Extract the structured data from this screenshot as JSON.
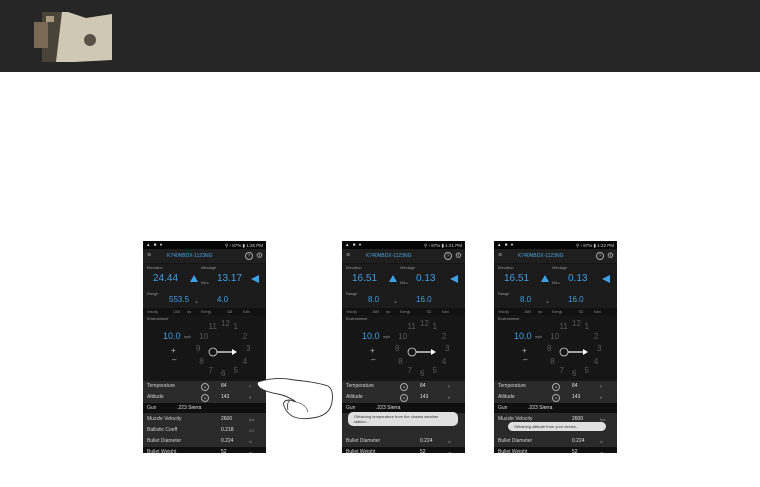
{
  "screens": [
    {
      "time": "1:26 PM",
      "device_title": "K740NBDX-1123NG",
      "labels": {
        "elevation": "Elevation",
        "windage": "Windage",
        "range": "Range",
        "velocity": "Velocity",
        "energy": "Energy",
        "drop": "Drop",
        "environment": "Environment"
      },
      "elevation": "24.44",
      "windage": "13.17",
      "mils": "MILs",
      "range": "553.5",
      "range_angle": "4.0",
      "wind_speed": "10.0",
      "wind_unit": "mph",
      "info": [
        "Velocity",
        "1305",
        "fps",
        "Energy",
        "328",
        "ft-lbs"
      ],
      "params": [
        {
          "label": "Temperature",
          "value": "84",
          "unit": "F"
        },
        {
          "label": "Altitude",
          "value": "143",
          "unit": "ft"
        },
        {
          "label": "Gun",
          "value": ".223 Sierra",
          "unit": ""
        },
        {
          "label": "Muzzle Velocity",
          "value": "2600",
          "unit": "fps"
        },
        {
          "label": "Ballistic Coeff",
          "value": "0.218",
          "unit": "G1"
        },
        {
          "label": "Bullet Diameter",
          "value": "0.224",
          "unit": "in"
        },
        {
          "label": "Bullet Weight",
          "value": "52",
          "unit": "gr"
        }
      ],
      "toast": ""
    },
    {
      "time": "1:21 PM",
      "device_title": "K740NBDX-1123NG",
      "labels": {
        "elevation": "Elevation",
        "windage": "Windage",
        "range": "Range",
        "velocity": "Velocity",
        "energy": "Energy",
        "drop": "Drop",
        "environment": "Environment"
      },
      "elevation": "16.51",
      "windage": "0.13",
      "mils": "MILs",
      "range": "8.0",
      "range_angle": "16.0",
      "wind_speed": "10.0",
      "wind_unit": "mph",
      "info": [
        "Velocity",
        "2589",
        "fps",
        "Energy",
        "782",
        "ft-lbs"
      ],
      "params": [
        {
          "label": "Temperature",
          "value": "84",
          "unit": "F"
        },
        {
          "label": "Altitude",
          "value": "143",
          "unit": "ft"
        },
        {
          "label": "Gun",
          "value": ".223 Sierra",
          "unit": ""
        },
        {
          "label": "",
          "value": "",
          "unit": ""
        },
        {
          "label": "",
          "value": "",
          "unit": ""
        },
        {
          "label": "Bullet Diameter",
          "value": "0.224",
          "unit": "in"
        },
        {
          "label": "Bullet Weight",
          "value": "52",
          "unit": "gr"
        }
      ],
      "toast": "Obtaining temperature from the closest weather station..."
    },
    {
      "time": "1:22 PM",
      "device_title": "K740NBDX-1123NG",
      "labels": {
        "elevation": "Elevation",
        "windage": "Windage",
        "range": "Range",
        "velocity": "Velocity",
        "energy": "Energy",
        "drop": "Drop",
        "environment": "Environment"
      },
      "elevation": "16.51",
      "windage": "0.13",
      "mils": "MILs",
      "range": "8.0",
      "range_angle": "16.0",
      "wind_speed": "10.0",
      "wind_unit": "mph",
      "info": [
        "Velocity",
        "2589",
        "fps",
        "Energy",
        "782",
        "ft-lbs"
      ],
      "params": [
        {
          "label": "Temperature",
          "value": "84",
          "unit": "F"
        },
        {
          "label": "Altitude",
          "value": "143",
          "unit": "ft"
        },
        {
          "label": "Gun",
          "value": ".223 Sierra",
          "unit": ""
        },
        {
          "label": "Muzzle Velocity",
          "value": "2600",
          "unit": "fps"
        },
        {
          "label": "",
          "value": "",
          "unit": ""
        },
        {
          "label": "Bullet Diameter",
          "value": "0.224",
          "unit": "in"
        },
        {
          "label": "Bullet Weight",
          "value": "52",
          "unit": "gr"
        }
      ],
      "toast": "Obtaining altitude from your device..."
    }
  ],
  "battery": "87%",
  "clock_numbers": [
    "12",
    "1",
    "2",
    "3",
    "4",
    "5",
    "6",
    "7",
    "8",
    "9",
    "10",
    "11"
  ],
  "colors": {
    "accent": "#3fa0e6",
    "banner": "#262626"
  },
  "icons": {
    "menu": "menu-icon",
    "help": "help-icon",
    "settings": "gear-icon",
    "up": "arrow-up-icon",
    "left": "arrow-left-icon",
    "hand": "hand-pointer-icon"
  }
}
